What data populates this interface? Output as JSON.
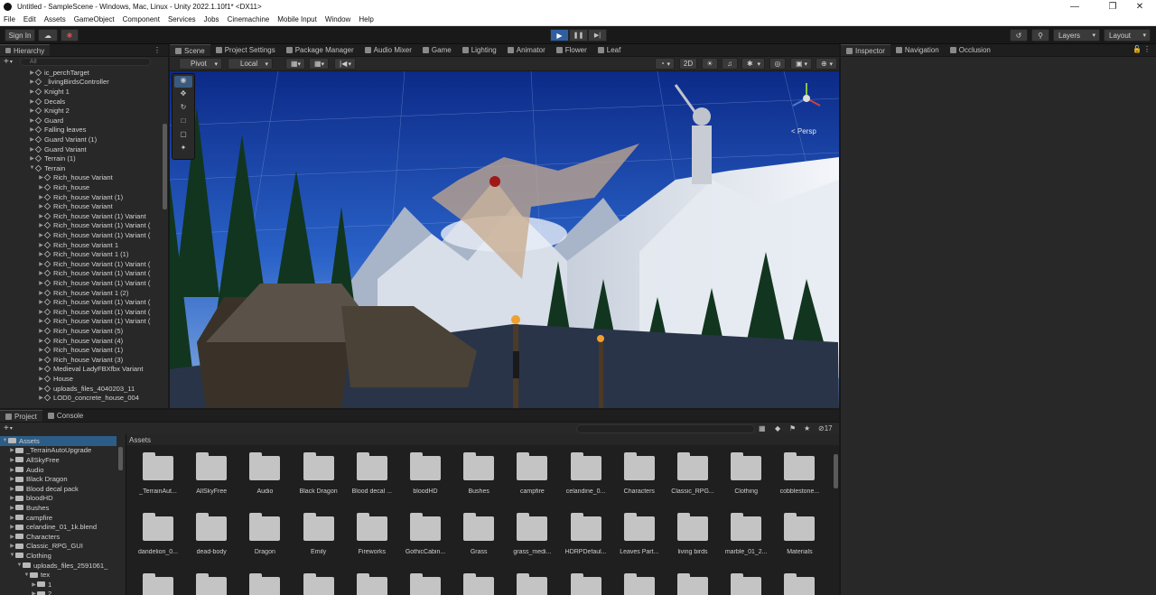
{
  "window": {
    "title": "Untitled - SampleScene - Windows, Mac, Linux - Unity 2022.1.10f1* <DX11>"
  },
  "menu": [
    "File",
    "Edit",
    "Assets",
    "GameObject",
    "Component",
    "Services",
    "Jobs",
    "Cinemachine",
    "Mobile Input",
    "Window",
    "Help"
  ],
  "toolbar": {
    "sign_in": "Sign In",
    "layers": "Layers",
    "layout": "Layout"
  },
  "hierarchy": {
    "tab": "Hierarchy",
    "search_placeholder": "All",
    "items": [
      {
        "label": "ic_perchTarget",
        "depth": 0,
        "kind": "go"
      },
      {
        "label": "_livingBirdsController",
        "depth": 0,
        "kind": "go"
      },
      {
        "label": "Knight 1",
        "depth": 0,
        "kind": "go"
      },
      {
        "label": "Decals",
        "depth": 0,
        "kind": "go"
      },
      {
        "label": "Knight 2",
        "depth": 0,
        "kind": "go"
      },
      {
        "label": "Guard",
        "depth": 0,
        "kind": "go"
      },
      {
        "label": "Falling leaves",
        "depth": 0,
        "kind": "go"
      },
      {
        "label": "Guard Variant (1)",
        "depth": 0,
        "kind": "go"
      },
      {
        "label": "Guard Variant",
        "depth": 0,
        "kind": "go"
      },
      {
        "label": "Terrain (1)",
        "depth": 0,
        "kind": "go"
      },
      {
        "label": "Terrain",
        "depth": 0,
        "kind": "go",
        "open": true
      },
      {
        "label": "Rich_house Variant",
        "depth": 1,
        "kind": "go"
      },
      {
        "label": "Rich_house",
        "depth": 1,
        "kind": "go"
      },
      {
        "label": "Rich_house Variant (1)",
        "depth": 1,
        "kind": "go"
      },
      {
        "label": "Rich_house Variant",
        "depth": 1,
        "kind": "go"
      },
      {
        "label": "Rich_house Variant (1) Variant",
        "depth": 1,
        "kind": "go"
      },
      {
        "label": "Rich_house Variant (1) Variant (",
        "depth": 1,
        "kind": "go"
      },
      {
        "label": "Rich_house Variant (1) Variant (",
        "depth": 1,
        "kind": "go"
      },
      {
        "label": "Rich_house Variant 1",
        "depth": 1,
        "kind": "go"
      },
      {
        "label": "Rich_house Variant 1 (1)",
        "depth": 1,
        "kind": "go"
      },
      {
        "label": "Rich_house Variant (1) Variant (",
        "depth": 1,
        "kind": "go"
      },
      {
        "label": "Rich_house Variant (1) Variant (",
        "depth": 1,
        "kind": "go"
      },
      {
        "label": "Rich_house Variant (1) Variant (",
        "depth": 1,
        "kind": "go"
      },
      {
        "label": "Rich_house Variant 1 (2)",
        "depth": 1,
        "kind": "go"
      },
      {
        "label": "Rich_house Variant (1) Variant (",
        "depth": 1,
        "kind": "go"
      },
      {
        "label": "Rich_house Variant (1) Variant (",
        "depth": 1,
        "kind": "go"
      },
      {
        "label": "Rich_house Variant (1) Variant (",
        "depth": 1,
        "kind": "go"
      },
      {
        "label": "Rich_house Variant (5)",
        "depth": 1,
        "kind": "go"
      },
      {
        "label": "Rich_house Variant (4)",
        "depth": 1,
        "kind": "go"
      },
      {
        "label": "Rich_house Variant (1)",
        "depth": 1,
        "kind": "go"
      },
      {
        "label": "Rich_house Variant (3)",
        "depth": 1,
        "kind": "go"
      },
      {
        "label": "Medieval LadyFBXfbx Variant",
        "depth": 1,
        "kind": "go"
      },
      {
        "label": "House",
        "depth": 1,
        "kind": "go"
      },
      {
        "label": "uploads_files_4040203_11",
        "depth": 1,
        "kind": "go"
      },
      {
        "label": "LOD0_concrete_house_004",
        "depth": 1,
        "kind": "go"
      }
    ]
  },
  "scene": {
    "tabs": [
      "Scene",
      "Project Settings",
      "Package Manager",
      "Audio Mixer",
      "Game",
      "Lighting",
      "Animator",
      "Flower",
      "Leaf"
    ],
    "pivot": "Pivot",
    "local": "Local",
    "mode_2d": "2D",
    "persp": "< Persp"
  },
  "inspector": {
    "tabs": [
      "Inspector",
      "Navigation",
      "Occlusion"
    ]
  },
  "project": {
    "tabs": [
      "Project",
      "Console"
    ],
    "assets_header": "Assets",
    "badge": "17",
    "tree": [
      {
        "label": "Assets",
        "depth": 0,
        "sel": true
      },
      {
        "label": "_TerrainAutoUpgrade",
        "depth": 1
      },
      {
        "label": "AllSkyFree",
        "depth": 1
      },
      {
        "label": "Audio",
        "depth": 1
      },
      {
        "label": "Black Dragon",
        "depth": 1
      },
      {
        "label": "Blood decal pack",
        "depth": 1
      },
      {
        "label": "bloodHD",
        "depth": 1
      },
      {
        "label": "Bushes",
        "depth": 1
      },
      {
        "label": "campfire",
        "depth": 1
      },
      {
        "label": "celandine_01_1k.blend",
        "depth": 1
      },
      {
        "label": "Characters",
        "depth": 1
      },
      {
        "label": "Classic_RPG_GUI",
        "depth": 1
      },
      {
        "label": "Clothing",
        "depth": 1
      },
      {
        "label": "uploads_files_2591061_",
        "depth": 2
      },
      {
        "label": "tex",
        "depth": 3
      },
      {
        "label": "1",
        "depth": 4
      },
      {
        "label": "2",
        "depth": 4
      }
    ],
    "folders": [
      "_TerrainAut...",
      "AllSkyFree",
      "Audio",
      "Black Dragon",
      "Blood decal ...",
      "bloodHD",
      "Bushes",
      "campfire",
      "celandine_0...",
      "Characters",
      "Classic_RPG...",
      "Clothing",
      "cobblestone...",
      "dandelion_0...",
      "dead-body",
      "Dragon",
      "Emily",
      "Fireworks",
      "GothicCabin...",
      "Grass",
      "grass_medi...",
      "HDRPDefaul...",
      "Leaves Part...",
      "living birds",
      "marble_01_2...",
      "Materials",
      "",
      "",
      "",
      "",
      "",
      "",
      "",
      "",
      "",
      "",
      "",
      "",
      ""
    ]
  },
  "colors": {
    "accent": "#2c5d87",
    "play_active": "#2f5fa0",
    "panel": "#282828",
    "bg": "#191919"
  }
}
